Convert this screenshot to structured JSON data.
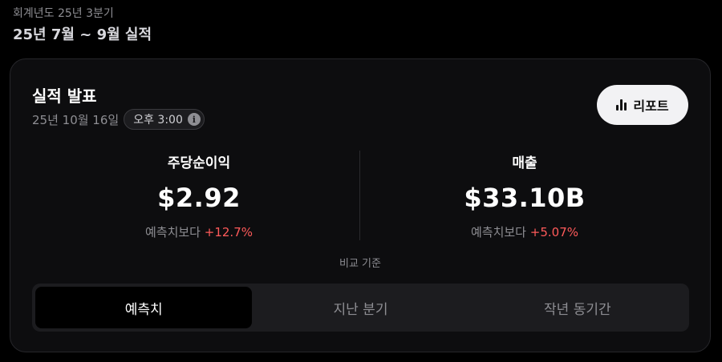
{
  "header": {
    "fiscal_label": "회계년도 25년 3분기",
    "period_title": "25년 7월 ~ 9월 실적"
  },
  "card": {
    "title": "실적 발표",
    "date": "25년 10월 16일",
    "time": "오후 3:00",
    "info_icon": "info-icon",
    "report_button": {
      "label": "리포트",
      "icon": "bar-chart-icon"
    }
  },
  "metrics": {
    "eps": {
      "label": "주당순이익",
      "value": "$2.92",
      "compare_text": "예측치보다",
      "delta": "+12.7%"
    },
    "revenue": {
      "label": "매출",
      "value": "$33.10B",
      "compare_text": "예측치보다",
      "delta": "+5.07%"
    }
  },
  "basis": {
    "label": "비교 기준",
    "options": [
      "예측치",
      "지난 분기",
      "작년 동기간"
    ],
    "selected": "예측치"
  },
  "colors": {
    "background": "#000000",
    "card": "#0d0d0f",
    "positive_delta": "#ff5a5a",
    "muted_text": "#8e8e93",
    "button_bg": "#f2f2f4"
  }
}
